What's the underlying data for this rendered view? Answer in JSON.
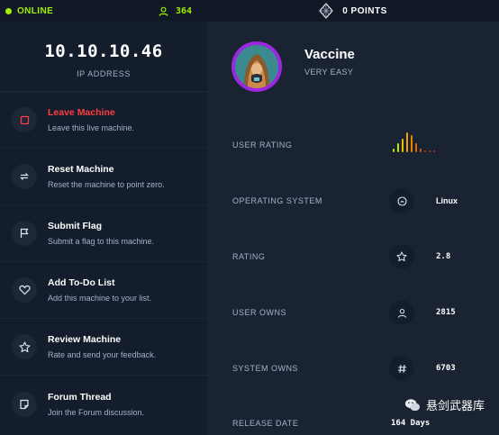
{
  "topbar": {
    "status": "ONLINE",
    "count": "364",
    "points": "0 POINTS"
  },
  "ip": {
    "address": "10.10.10.46",
    "label": "IP ADDRESS"
  },
  "menu": [
    {
      "title": "Leave Machine",
      "sub": "Leave this live machine."
    },
    {
      "title": "Reset Machine",
      "sub": "Reset the machine to point zero."
    },
    {
      "title": "Submit Flag",
      "sub": "Submit a flag to this machine."
    },
    {
      "title": "Add To-Do List",
      "sub": "Add this machine to your list."
    },
    {
      "title": "Review Machine",
      "sub": "Rate and send your feedback."
    },
    {
      "title": "Forum Thread",
      "sub": "Join the Forum discussion."
    }
  ],
  "machine": {
    "name": "Vaccine",
    "difficulty": "VERY EASY"
  },
  "stats": {
    "user_rating_label": "USER RATING",
    "user_rating_bars": [
      0.2,
      0.45,
      0.7,
      1.0,
      0.85,
      0.45,
      0.2,
      0.08,
      0.08,
      0.08
    ],
    "os_label": "OPERATING SYSTEM",
    "os_value": "Linux",
    "rating_label": "RATING",
    "rating_value": "2.8",
    "user_owns_label": "USER OWNS",
    "user_owns_value": "2815",
    "system_owns_label": "SYSTEM OWNS",
    "system_owns_value": "6703",
    "release_label": "RELEASE DATE",
    "release_value": "164 Days"
  },
  "watermark": "悬剑武器库",
  "colors": {
    "accent_green": "#9fef00",
    "danger_red": "#ff3e3e",
    "avatar_ring": "#9c27e0",
    "bar_colors": [
      "#9fef00",
      "#c6e000",
      "#e6c000",
      "#f0a000",
      "#f08000",
      "#e06a00",
      "#d05a00",
      "#c04a00",
      "#b83a00",
      "#b83a00"
    ]
  }
}
